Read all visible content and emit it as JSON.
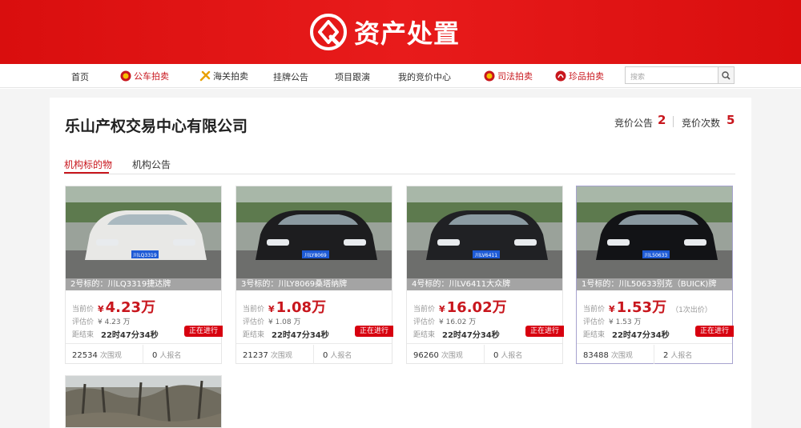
{
  "banner": {
    "title": "资产处置"
  },
  "nav": {
    "items": [
      {
        "label": "首页",
        "icon": ""
      },
      {
        "label": "公车拍卖",
        "icon": "emblem-icon"
      },
      {
        "label": "海关拍卖",
        "icon": "customs-icon"
      },
      {
        "label": "挂牌公告",
        "icon": ""
      },
      {
        "label": "项目跟演",
        "icon": ""
      },
      {
        "label": "我的竞价中心",
        "icon": ""
      },
      {
        "label": "司法拍卖",
        "icon": "emblem-icon"
      },
      {
        "label": "珍品拍卖",
        "icon": "treasure-icon"
      }
    ],
    "search_placeholder": "搜索"
  },
  "org": {
    "name": "乐山产权交易中心有限公司",
    "stats": [
      {
        "label": "竞价公告",
        "value": "2"
      },
      {
        "label": "竞价次数",
        "value": "5"
      }
    ]
  },
  "tabs": [
    {
      "label": "机构标的物",
      "active": true
    },
    {
      "label": "机构公告",
      "active": false
    }
  ],
  "labels": {
    "current_price": "当前价",
    "appraisal": "评估价",
    "remaining": "距结束",
    "views_suffix": "次围观",
    "signup_suffix": "人报名",
    "yen": "¥"
  },
  "cards": [
    {
      "title": "2号标的：川LQ3319捷达牌",
      "price": "4.23万",
      "price_extra": "",
      "appraisal": "¥ 4.23 万",
      "remaining": "22时47分34秒",
      "status": "正在进行",
      "views": "22534",
      "signups": "0",
      "plate": "川LQ3319",
      "car_color": "#e8e8e6"
    },
    {
      "title": "3号标的：川LY8069桑塔纳牌",
      "price": "1.08万",
      "price_extra": "",
      "appraisal": "¥ 1.08 万",
      "remaining": "22时47分34秒",
      "status": "正在进行",
      "views": "21237",
      "signups": "0",
      "plate": "川LY8069",
      "car_color": "#1d1d1f"
    },
    {
      "title": "4号标的：川LV6411大众牌",
      "price": "16.02万",
      "price_extra": "",
      "appraisal": "¥ 16.02 万",
      "remaining": "22时47分34秒",
      "status": "正在进行",
      "views": "96260",
      "signups": "0",
      "plate": "川LV6411",
      "car_color": "#202124"
    },
    {
      "title": "1号标的：川L50633别克（BUICK)牌",
      "price": "1.53万",
      "price_extra": "（1次出价）",
      "appraisal": "¥ 1.53 万",
      "remaining": "22时47分34秒",
      "status": "正在进行",
      "views": "83488",
      "signups": "2",
      "plate": "川L50633",
      "car_color": "#121316"
    }
  ]
}
